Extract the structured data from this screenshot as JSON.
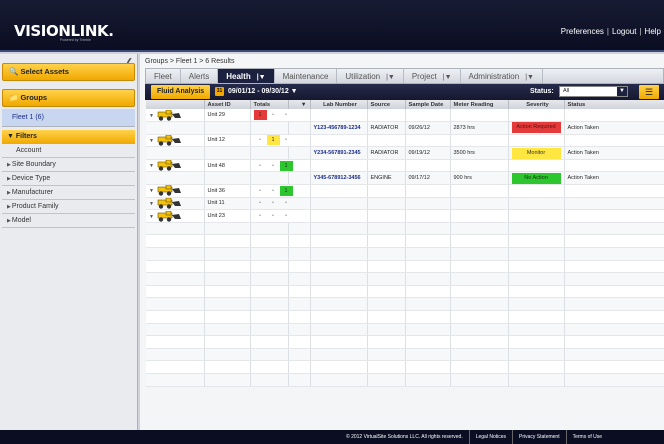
{
  "header": {
    "logo": "VISIONLINK.",
    "logo_sub": "Powered by Trimble",
    "links": [
      "Preferences",
      "Logout",
      "Help"
    ]
  },
  "sidebar": {
    "select_assets": "Select Assets",
    "groups": "Groups",
    "fleet": "Fleet 1 (6)",
    "filters": "Filters",
    "filter_items": [
      "Account",
      "Site Boundary",
      "Device Type",
      "Manufacturer",
      "Product Family",
      "Model"
    ]
  },
  "breadcrumb": "Groups > Fleet 1 > 6 Results",
  "tabs": [
    "Fleet",
    "Alerts",
    "Health",
    "Maintenance",
    "Utilization",
    "Project",
    "Administration"
  ],
  "subbar": {
    "fluid_analysis": "Fluid Analysis",
    "date_range": "09/01/12 - 09/30/12",
    "status_label": "Status:",
    "status_value": "All"
  },
  "table": {
    "headers": [
      "",
      "Asset ID",
      "Totals",
      "",
      "Lab Number",
      "Source",
      "Sample Date",
      "Meter Reading",
      "Severity",
      "Status"
    ],
    "rows": [
      {
        "asset": "Unit 29",
        "lab": "",
        "source": "",
        "date": "",
        "meter": "",
        "severity": "",
        "status": ""
      },
      {
        "asset": "",
        "lab": "Y123-456789-1234",
        "source": "RADIATOR",
        "date": "09/26/12",
        "meter": "2873 hrs",
        "severity": "Action Required",
        "status": "Action Taken"
      },
      {
        "asset": "Unit 12",
        "lab": "",
        "source": "",
        "date": "",
        "meter": "",
        "severity": "",
        "status": ""
      },
      {
        "asset": "",
        "lab": "Y234-567891-2345",
        "source": "RADIATOR",
        "date": "09/19/12",
        "meter": "3500 hrs",
        "severity": "Monitor",
        "status": "Action Taken"
      },
      {
        "asset": "Unit 48",
        "lab": "",
        "source": "",
        "date": "",
        "meter": "",
        "severity": "",
        "status": ""
      },
      {
        "asset": "",
        "lab": "Y345-678912-3456",
        "source": "ENGINE",
        "date": "09/17/12",
        "meter": "900 hrs",
        "severity": "No Action",
        "status": "Action Taken"
      },
      {
        "asset": "Unit 36",
        "lab": "",
        "source": "",
        "date": "",
        "meter": "",
        "severity": "",
        "status": ""
      },
      {
        "asset": "Unit 11",
        "lab": "",
        "source": "",
        "date": "",
        "meter": "",
        "severity": "",
        "status": ""
      },
      {
        "asset": "Unit 23",
        "lab": "",
        "source": "",
        "date": "",
        "meter": "",
        "severity": "",
        "status": ""
      }
    ],
    "marker_1": "1"
  },
  "footer": {
    "copyright": "© 2012 VirtualSite Solutions LLC. All rights reserved.",
    "links": [
      "Legal Notices",
      "Privacy Statement",
      "Terms of Use"
    ]
  },
  "colors": {
    "accent": "#f0a800",
    "nav": "#1d2140",
    "red": "#e53a3a",
    "yellow": "#ffe640",
    "green": "#2ec62e"
  }
}
